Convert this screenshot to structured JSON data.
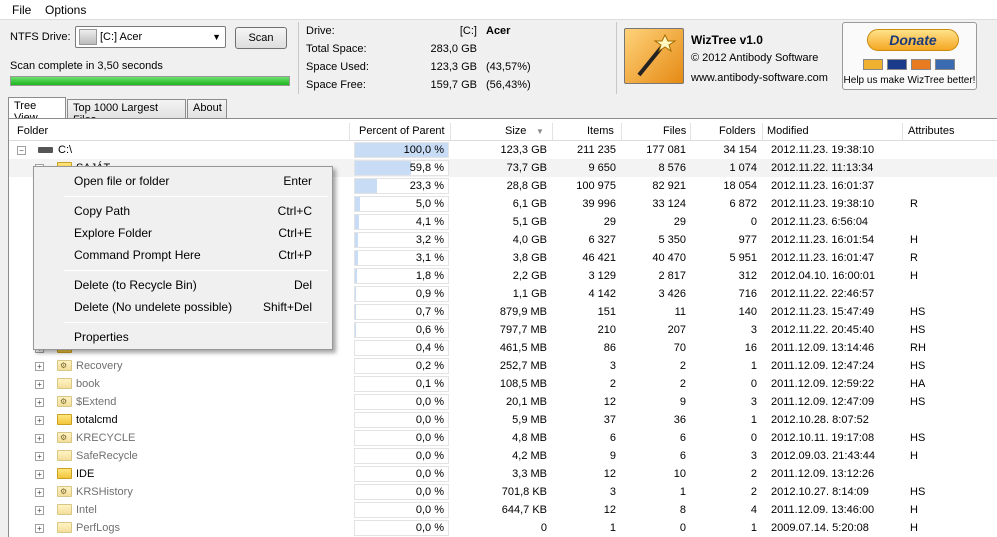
{
  "menu": {
    "file": "File",
    "options": "Options"
  },
  "toolbar": {
    "ntfs_label": "NTFS Drive:",
    "drive_value": "[C:] Acer",
    "scan_label": "Scan",
    "status": "Scan complete in 3,50 seconds",
    "progress": 1.0
  },
  "drive_info": {
    "drive_label": "Drive:",
    "drive_letter": "[C:]",
    "drive_name": "Acer",
    "total_label": "Total Space:",
    "total_value": "283,0 GB",
    "used_label": "Space Used:",
    "used_value": "123,3 GB",
    "used_pct": "(43,57%)",
    "free_label": "Space Free:",
    "free_value": "159,7 GB",
    "free_pct": "(56,43%)"
  },
  "about": {
    "title": "WizTree v1.0",
    "copyright": "© 2012 Antibody Software",
    "url": "www.antibody-software.com"
  },
  "donate": {
    "label": "Donate",
    "caption": "Help us make WizTree better!",
    "cards": [
      "MC",
      "VISA",
      "DISC",
      "BANK"
    ]
  },
  "tabs": [
    "Tree View",
    "Top 1000 Largest Files",
    "About"
  ],
  "columns": {
    "folder": "Folder",
    "percent": "Percent of Parent",
    "size": "Size",
    "items": "Items",
    "files": "Files",
    "folders": "Folders",
    "modified": "Modified",
    "attributes": "Attributes"
  },
  "rows": [
    {
      "name": "C:\\",
      "pct": "100,0 %",
      "pctv": 1.0,
      "size": "123,3 GB",
      "items": "211 235",
      "files": "177 081",
      "folders": "34 154",
      "modified": "2012.11.23. 19:38:10",
      "attr": ""
    },
    {
      "name": "SAJÁT",
      "pct": "59,8 %",
      "pctv": 0.598,
      "size": "73,7 GB",
      "items": "9 650",
      "files": "8 576",
      "folders": "1 074",
      "modified": "2012.11.22. 11:13:34",
      "attr": ""
    },
    {
      "name": "",
      "pct": "23,3 %",
      "pctv": 0.233,
      "size": "28,8 GB",
      "items": "100 975",
      "files": "82 921",
      "folders": "18 054",
      "modified": "2012.11.23. 16:01:37",
      "attr": ""
    },
    {
      "name": "",
      "pct": "5,0 %",
      "pctv": 0.05,
      "size": "6,1 GB",
      "items": "39 996",
      "files": "33 124",
      "folders": "6 872",
      "modified": "2012.11.23. 19:38:10",
      "attr": "R"
    },
    {
      "name": "",
      "pct": "4,1 %",
      "pctv": 0.041,
      "size": "5,1 GB",
      "items": "29",
      "files": "29",
      "folders": "0",
      "modified": "2012.11.23. 6:56:04",
      "attr": ""
    },
    {
      "name": "",
      "pct": "3,2 %",
      "pctv": 0.032,
      "size": "4,0 GB",
      "items": "6 327",
      "files": "5 350",
      "folders": "977",
      "modified": "2012.11.23. 16:01:54",
      "attr": "H"
    },
    {
      "name": "",
      "pct": "3,1 %",
      "pctv": 0.031,
      "size": "3,8 GB",
      "items": "46 421",
      "files": "40 470",
      "folders": "5 951",
      "modified": "2012.11.23. 16:01:47",
      "attr": "R"
    },
    {
      "name": "",
      "pct": "1,8 %",
      "pctv": 0.018,
      "size": "2,2 GB",
      "items": "3 129",
      "files": "2 817",
      "folders": "312",
      "modified": "2012.04.10. 16:00:01",
      "attr": "H"
    },
    {
      "name": "",
      "pct": "0,9 %",
      "pctv": 0.009,
      "size": "1,1 GB",
      "items": "4 142",
      "files": "3 426",
      "folders": "716",
      "modified": "2012.11.22. 22:46:57",
      "attr": ""
    },
    {
      "name": "",
      "pct": "0,7 %",
      "pctv": 0.007,
      "size": "879,9 MB",
      "items": "151",
      "files": "11",
      "folders": "140",
      "modified": "2012.11.23. 15:47:49",
      "attr": "HS"
    },
    {
      "name": "",
      "pct": "0,6 %",
      "pctv": 0.006,
      "size": "797,7 MB",
      "items": "210",
      "files": "207",
      "folders": "3",
      "modified": "2012.11.22. 20:45:40",
      "attr": "HS"
    },
    {
      "name": "",
      "pct": "0,4 %",
      "pctv": 0.004,
      "size": "461,5 MB",
      "items": "86",
      "files": "70",
      "folders": "16",
      "modified": "2011.12.09. 13:14:46",
      "attr": "RH"
    },
    {
      "name": "Recovery",
      "pct": "0,2 %",
      "pctv": 0.002,
      "size": "252,7 MB",
      "items": "3",
      "files": "2",
      "folders": "1",
      "modified": "2011.12.09. 12:47:24",
      "attr": "HS"
    },
    {
      "name": "book",
      "pct": "0,1 %",
      "pctv": 0.001,
      "size": "108,5 MB",
      "items": "2",
      "files": "2",
      "folders": "0",
      "modified": "2011.12.09. 12:59:22",
      "attr": "HA"
    },
    {
      "name": "$Extend",
      "pct": "0,0 %",
      "pctv": 0,
      "size": "20,1 MB",
      "items": "12",
      "files": "9",
      "folders": "3",
      "modified": "2011.12.09. 12:47:09",
      "attr": "HS"
    },
    {
      "name": "totalcmd",
      "pct": "0,0 %",
      "pctv": 0,
      "size": "5,9 MB",
      "items": "37",
      "files": "36",
      "folders": "1",
      "modified": "2012.10.28. 8:07:52",
      "attr": ""
    },
    {
      "name": "KRECYCLE",
      "pct": "0,0 %",
      "pctv": 0,
      "size": "4,8 MB",
      "items": "6",
      "files": "6",
      "folders": "0",
      "modified": "2012.10.11. 19:17:08",
      "attr": "HS"
    },
    {
      "name": "SafeRecycle",
      "pct": "0,0 %",
      "pctv": 0,
      "size": "4,2 MB",
      "items": "9",
      "files": "6",
      "folders": "3",
      "modified": "2012.09.03. 21:43:44",
      "attr": "H"
    },
    {
      "name": "IDE",
      "pct": "0,0 %",
      "pctv": 0,
      "size": "3,3 MB",
      "items": "12",
      "files": "10",
      "folders": "2",
      "modified": "2011.12.09. 13:12:26",
      "attr": ""
    },
    {
      "name": "KRSHistory",
      "pct": "0,0 %",
      "pctv": 0,
      "size": "701,8 KB",
      "items": "3",
      "files": "1",
      "folders": "2",
      "modified": "2012.10.27. 8:14:09",
      "attr": "HS"
    },
    {
      "name": "Intel",
      "pct": "0,0 %",
      "pctv": 0,
      "size": "644,7 KB",
      "items": "12",
      "files": "8",
      "folders": "4",
      "modified": "2011.12.09. 13:46:00",
      "attr": "H"
    },
    {
      "name": "PerfLogs",
      "pct": "0,0 %",
      "pctv": 0,
      "size": "0",
      "items": "1",
      "files": "0",
      "folders": "1",
      "modified": "2009.07.14. 5:20:08",
      "attr": "H"
    }
  ],
  "context_menu": [
    {
      "label": "Open file or folder",
      "shortcut": "Enter"
    },
    {
      "label": "Copy Path",
      "shortcut": "Ctrl+C"
    },
    {
      "label": "Explore Folder",
      "shortcut": "Ctrl+E"
    },
    {
      "label": "Command Prompt Here",
      "shortcut": "Ctrl+P"
    },
    {
      "label": "Delete (to Recycle Bin)",
      "shortcut": "Del"
    },
    {
      "label": "Delete (No undelete possible)",
      "shortcut": "Shift+Del"
    },
    {
      "label": "Properties",
      "shortcut": ""
    }
  ]
}
